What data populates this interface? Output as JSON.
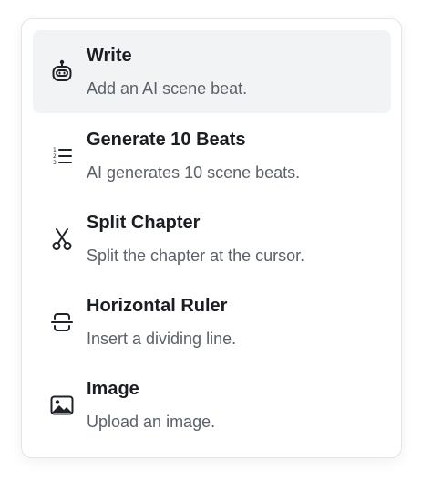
{
  "menu": {
    "items": [
      {
        "title": "Write",
        "description": "Add an AI scene beat.",
        "icon": "robot-icon",
        "active": true
      },
      {
        "title": "Generate 10 Beats",
        "description": "AI generates 10 scene beats.",
        "icon": "numbered-list-icon",
        "active": false
      },
      {
        "title": "Split Chapter",
        "description": "Split the chapter at the cursor.",
        "icon": "scissors-icon",
        "active": false
      },
      {
        "title": "Horizontal Ruler",
        "description": "Insert a dividing line.",
        "icon": "horizontal-rule-icon",
        "active": false
      },
      {
        "title": "Image",
        "description": "Upload an image.",
        "icon": "image-icon",
        "active": false
      }
    ]
  },
  "colors": {
    "active_background": "#f2f3f5",
    "title_text": "#1a1d21",
    "description_text": "#5b6169",
    "border": "#e3e5e8"
  }
}
